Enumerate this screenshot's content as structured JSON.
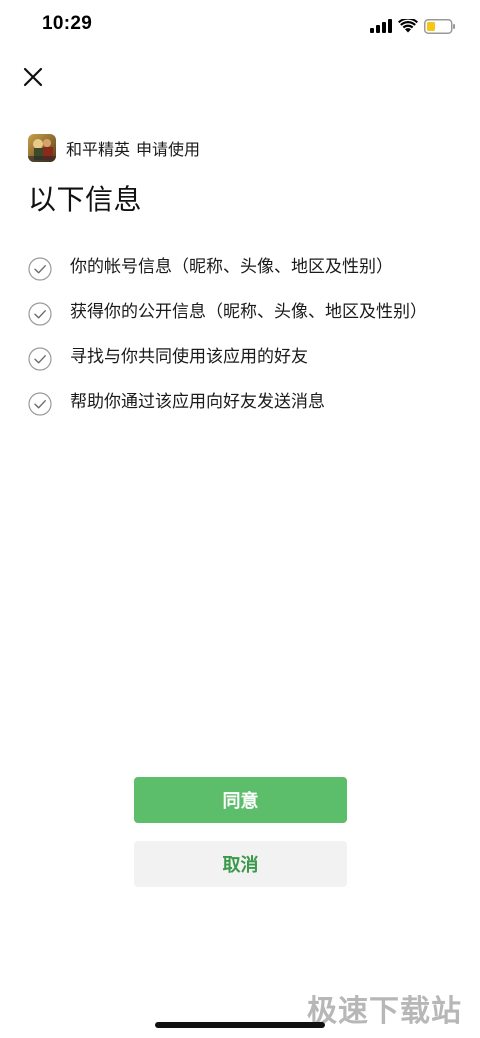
{
  "status_bar": {
    "time": "10:29",
    "icons": [
      "signal-icon",
      "wifi-icon",
      "battery-icon"
    ],
    "battery_color": "#f5c518"
  },
  "header": {
    "close_icon": "close-icon",
    "app_name": "和平精英",
    "request_text": "申请使用"
  },
  "title": "以下信息",
  "permissions": [
    "你的帐号信息（昵称、头像、地区及性别）",
    "获得你的公开信息（昵称、头像、地区及性别）",
    "寻找与你共同使用该应用的好友",
    "帮助你通过该应用向好友发送消息"
  ],
  "buttons": {
    "agree_label": "同意",
    "cancel_label": "取消"
  },
  "colors": {
    "agree_bg": "#5cbd6a",
    "agree_text": "#ffffff",
    "cancel_bg": "#f2f2f2",
    "cancel_text": "#3a9a4a"
  },
  "watermark": "极速下载站"
}
